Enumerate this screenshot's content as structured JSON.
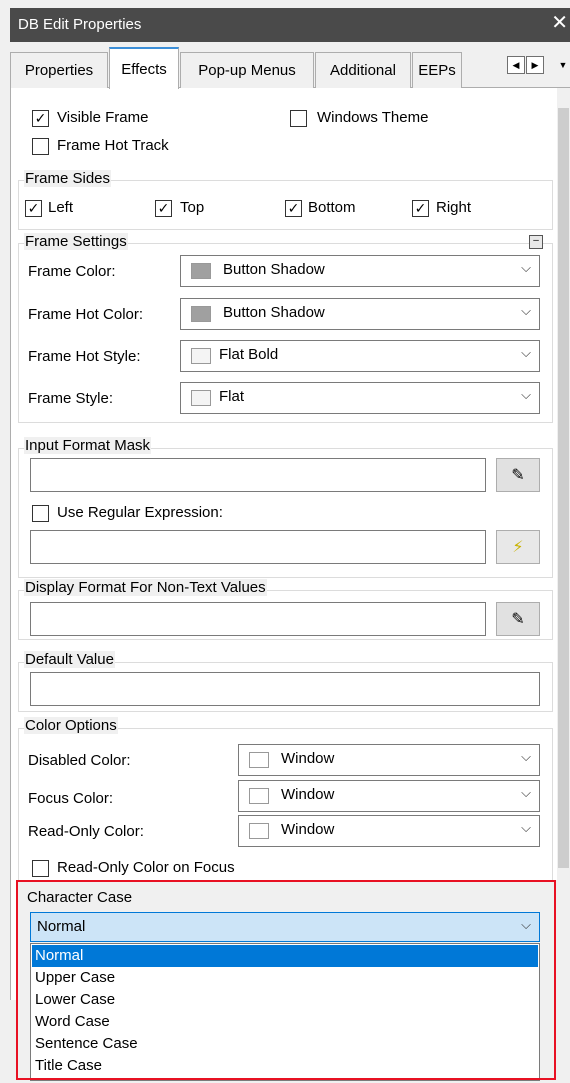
{
  "window": {
    "title": "DB Edit Properties",
    "close_glyph": "✕"
  },
  "tabs": [
    "Properties",
    "Effects",
    "Pop-up Menus",
    "Additional",
    "EEPs"
  ],
  "active_tab": "Effects",
  "top": {
    "visible_frame": {
      "label": "Visible Frame",
      "checked": true
    },
    "windows_theme": {
      "label": "Windows Theme",
      "checked": false
    },
    "frame_hot_track": {
      "label": "Frame Hot Track",
      "checked": false
    }
  },
  "frame_sides": {
    "legend": "Frame Sides",
    "left": {
      "label": "Left",
      "checked": true
    },
    "top": {
      "label": "Top",
      "checked": true
    },
    "bottom": {
      "label": "Bottom",
      "checked": true
    },
    "right": {
      "label": "Right",
      "checked": true
    }
  },
  "frame_settings": {
    "legend": "Frame Settings",
    "frame_color": {
      "label": "Frame Color:",
      "value": "Button Shadow",
      "swatch": "#a0a0a0"
    },
    "frame_hot_color": {
      "label": "Frame Hot Color:",
      "value": "Button Shadow",
      "swatch": "#a0a0a0"
    },
    "frame_hot_style": {
      "label": "Frame Hot Style:",
      "value": "Flat Bold"
    },
    "frame_style": {
      "label": "Frame Style:",
      "value": "Flat"
    }
  },
  "input_format": {
    "legend": "Input Format Mask",
    "value": "",
    "use_regex": {
      "label": "Use Regular Expression:",
      "checked": false
    },
    "regex_value": ""
  },
  "display_format": {
    "legend": "Display Format For Non-Text Values",
    "value": ""
  },
  "default_value": {
    "legend": "Default Value",
    "value": ""
  },
  "color_options": {
    "legend": "Color Options",
    "disabled_color": {
      "label": "Disabled Color:",
      "value": "Window"
    },
    "focus_color": {
      "label": "Focus Color:",
      "value": "Window"
    },
    "readonly_color": {
      "label": "Read-Only Color:",
      "value": "Window"
    },
    "readonly_on_focus": {
      "label": "Read-Only Color on Focus",
      "checked": false
    }
  },
  "character_case": {
    "legend": "Character Case",
    "selected": "Normal",
    "options": [
      "Normal",
      "Upper Case",
      "Lower Case",
      "Word Case",
      "Sentence Case",
      "Title Case"
    ]
  },
  "colors": {
    "accent": "#0078d7",
    "highlight_border": "#e81123",
    "titlebar": "#4a4a4a"
  }
}
